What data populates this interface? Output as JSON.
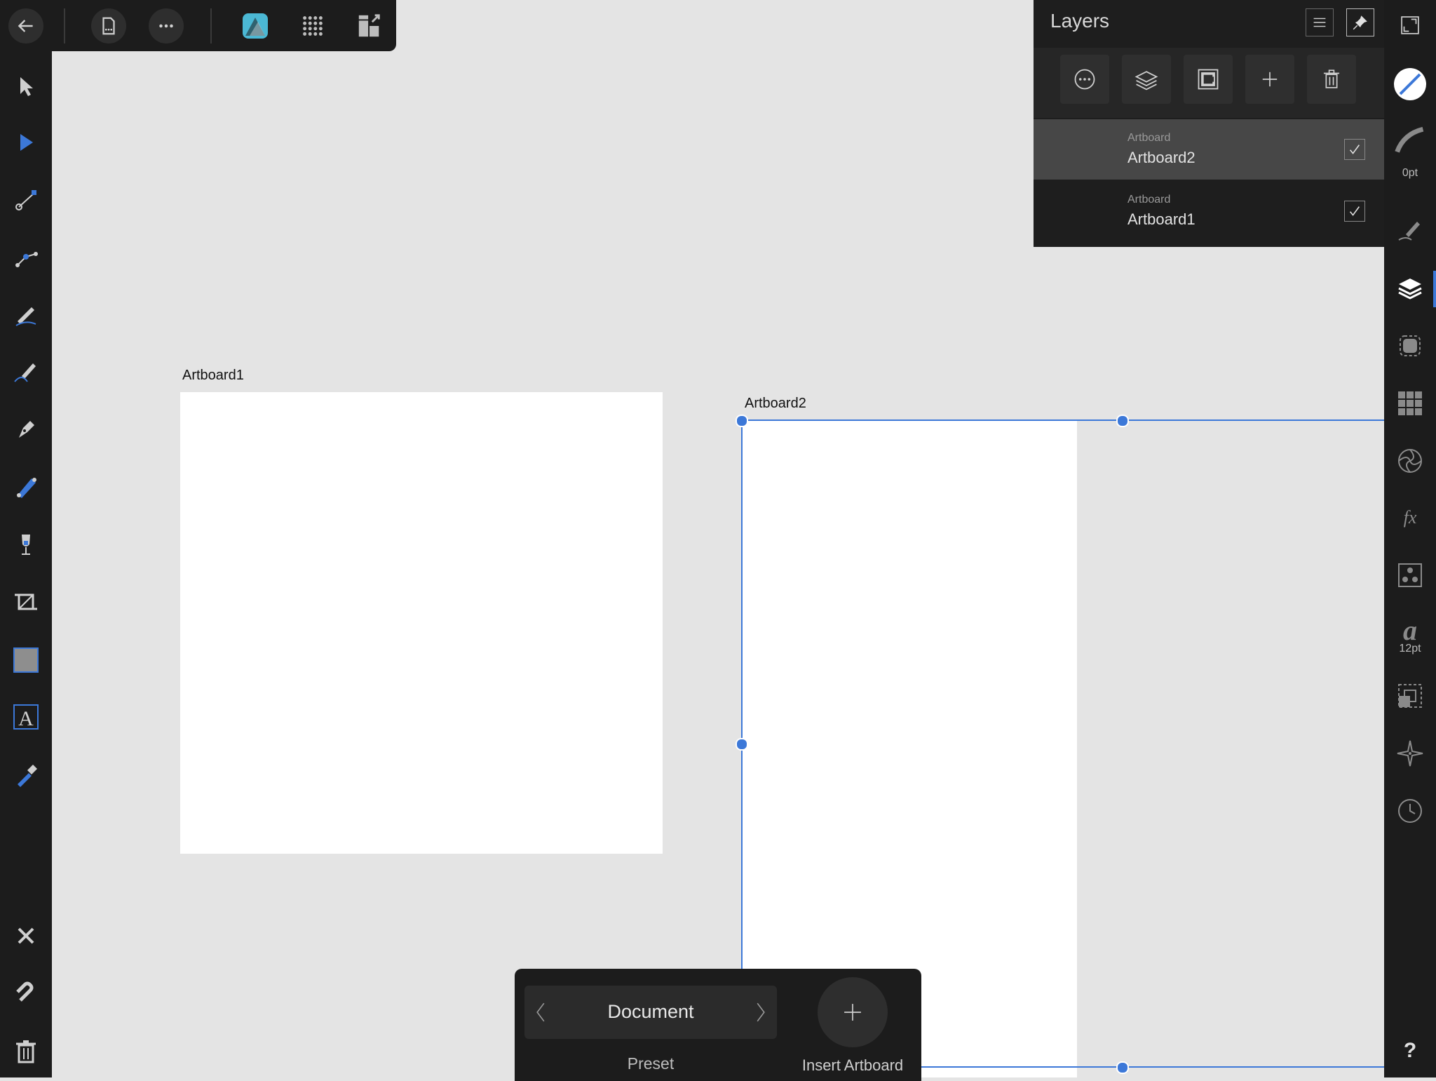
{
  "layers_panel": {
    "title": "Layers",
    "layers": [
      {
        "kind": "Artboard",
        "name": "Artboard2",
        "visible": true,
        "selected": true
      },
      {
        "kind": "Artboard",
        "name": "Artboard1",
        "visible": true,
        "selected": false
      }
    ]
  },
  "canvas": {
    "artboards": [
      {
        "label": "Artboard1"
      },
      {
        "label": "Artboard2"
      }
    ]
  },
  "studio": {
    "stroke_width": "0pt",
    "font_size": "12pt",
    "help": "?"
  },
  "context_toolbar": {
    "preset_value": "Document",
    "preset_label": "Preset",
    "insert_label": "Insert Artboard"
  },
  "colors": {
    "accent": "#3c78d8",
    "toolbar_bg": "#1c1c1c",
    "canvas_bg": "#e4e4e4",
    "app_icon": "#4bb8d4"
  }
}
